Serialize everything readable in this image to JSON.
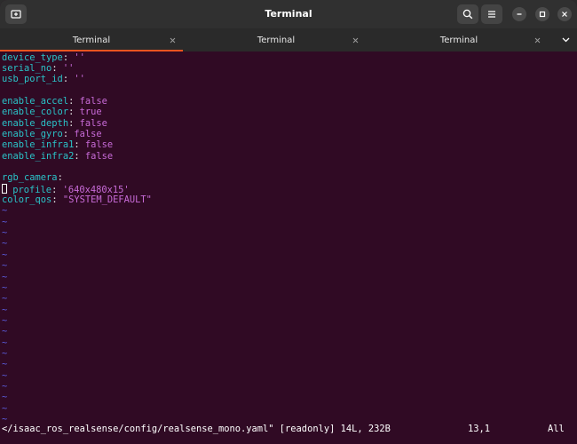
{
  "window": {
    "title": "Terminal",
    "new_tab_icon": "new-tab-icon",
    "search_icon": "search-icon",
    "menu_icon": "hamburger-menu-icon",
    "minimize_icon": "minimize-icon",
    "maximize_icon": "maximize-icon",
    "close_icon": "close-icon"
  },
  "tabs": [
    {
      "label": "Terminal",
      "active": true
    },
    {
      "label": "Terminal",
      "active": false
    },
    {
      "label": "Terminal",
      "active": false
    }
  ],
  "accent_color": "#e95420",
  "editor": {
    "lines": [
      {
        "key": "device_type",
        "value": "''"
      },
      {
        "key": "serial_no",
        "value": "''"
      },
      {
        "key": "usb_port_id",
        "value": "''"
      },
      {
        "key": "",
        "value": ""
      },
      {
        "key": "enable_accel",
        "value": "false"
      },
      {
        "key": "enable_color",
        "value": "true"
      },
      {
        "key": "enable_depth",
        "value": "false"
      },
      {
        "key": "enable_gyro",
        "value": "false"
      },
      {
        "key": "enable_infra1",
        "value": "false"
      },
      {
        "key": "enable_infra2",
        "value": "false"
      },
      {
        "key": "",
        "value": ""
      },
      {
        "key": "rgb_camera",
        "value": ""
      },
      {
        "key": "profile",
        "value": "'640x480x15'",
        "indent": " "
      },
      {
        "key": "color_qos",
        "value": "\"SYSTEM_DEFAULT\""
      }
    ],
    "empty_line_marker": "~",
    "empty_line_count": 20
  },
  "status_bar": {
    "file": "</isaac_ros_realsense/config/realsense_mono.yaml\" [readonly] 14L, 232B",
    "position": "13,1",
    "scroll": "All"
  }
}
